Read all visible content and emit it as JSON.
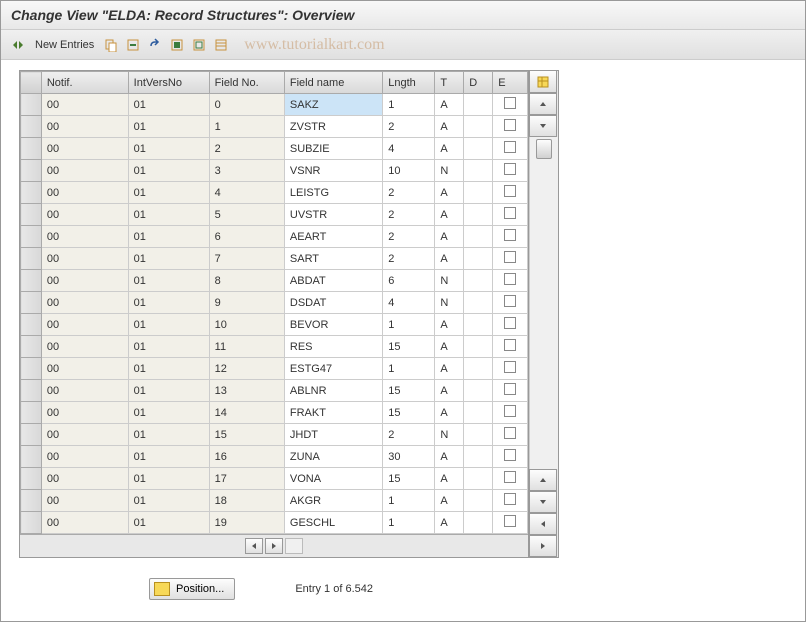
{
  "title": "Change View \"ELDA: Record Structures\": Overview",
  "toolbar": {
    "new_entries_label": "New Entries"
  },
  "watermark": "www.tutorialkart.com",
  "table": {
    "headers": {
      "notif": "Notif.",
      "intvers": "IntVersNo",
      "fieldno": "Field No.",
      "fieldname": "Field name",
      "lngth": "Lngth",
      "t": "T",
      "d": "D",
      "e": "E"
    },
    "rows": [
      {
        "notif": "00",
        "intvers": "01",
        "fieldno": "0",
        "fieldname": "SAKZ",
        "lngth": "1",
        "t": "A",
        "highlighted": true
      },
      {
        "notif": "00",
        "intvers": "01",
        "fieldno": "1",
        "fieldname": "ZVSTR",
        "lngth": "2",
        "t": "A"
      },
      {
        "notif": "00",
        "intvers": "01",
        "fieldno": "2",
        "fieldname": "SUBZIE",
        "lngth": "4",
        "t": "A"
      },
      {
        "notif": "00",
        "intvers": "01",
        "fieldno": "3",
        "fieldname": "VSNR",
        "lngth": "10",
        "t": "N"
      },
      {
        "notif": "00",
        "intvers": "01",
        "fieldno": "4",
        "fieldname": "LEISTG",
        "lngth": "2",
        "t": "A"
      },
      {
        "notif": "00",
        "intvers": "01",
        "fieldno": "5",
        "fieldname": "UVSTR",
        "lngth": "2",
        "t": "A"
      },
      {
        "notif": "00",
        "intvers": "01",
        "fieldno": "6",
        "fieldname": "AEART",
        "lngth": "2",
        "t": "A"
      },
      {
        "notif": "00",
        "intvers": "01",
        "fieldno": "7",
        "fieldname": "SART",
        "lngth": "2",
        "t": "A"
      },
      {
        "notif": "00",
        "intvers": "01",
        "fieldno": "8",
        "fieldname": "ABDAT",
        "lngth": "6",
        "t": "N"
      },
      {
        "notif": "00",
        "intvers": "01",
        "fieldno": "9",
        "fieldname": "DSDAT",
        "lngth": "4",
        "t": "N"
      },
      {
        "notif": "00",
        "intvers": "01",
        "fieldno": "10",
        "fieldname": "BEVOR",
        "lngth": "1",
        "t": "A"
      },
      {
        "notif": "00",
        "intvers": "01",
        "fieldno": "11",
        "fieldname": "RES",
        "lngth": "15",
        "t": "A"
      },
      {
        "notif": "00",
        "intvers": "01",
        "fieldno": "12",
        "fieldname": "ESTG47",
        "lngth": "1",
        "t": "A"
      },
      {
        "notif": "00",
        "intvers": "01",
        "fieldno": "13",
        "fieldname": "ABLNR",
        "lngth": "15",
        "t": "A"
      },
      {
        "notif": "00",
        "intvers": "01",
        "fieldno": "14",
        "fieldname": "FRAKT",
        "lngth": "15",
        "t": "A"
      },
      {
        "notif": "00",
        "intvers": "01",
        "fieldno": "15",
        "fieldname": "JHDT",
        "lngth": "2",
        "t": "N"
      },
      {
        "notif": "00",
        "intvers": "01",
        "fieldno": "16",
        "fieldname": "ZUNA",
        "lngth": "30",
        "t": "A"
      },
      {
        "notif": "00",
        "intvers": "01",
        "fieldno": "17",
        "fieldname": "VONA",
        "lngth": "15",
        "t": "A"
      },
      {
        "notif": "00",
        "intvers": "01",
        "fieldno": "18",
        "fieldname": "AKGR",
        "lngth": "1",
        "t": "A"
      },
      {
        "notif": "00",
        "intvers": "01",
        "fieldno": "19",
        "fieldname": "GESCHL",
        "lngth": "1",
        "t": "A"
      }
    ]
  },
  "footer": {
    "position_label": "Position...",
    "entry_text": "Entry 1 of 6.542"
  }
}
